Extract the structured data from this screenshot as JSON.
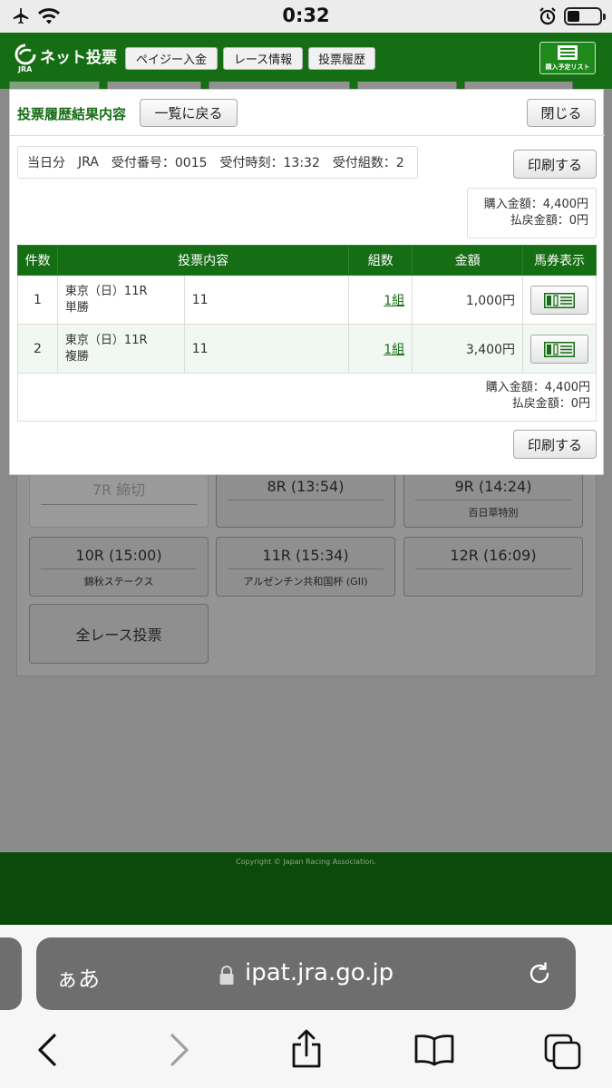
{
  "status_bar": {
    "time": "0:32"
  },
  "header": {
    "logo_text": "ネット投票",
    "logo_small": "JRA",
    "nav": [
      "ペイジー入金",
      "レース情報",
      "投票履歴"
    ],
    "purchase_list_label": "購入予定リスト"
  },
  "background": {
    "races": [
      {
        "time": "7R 締切",
        "name": ""
      },
      {
        "time": "8R (13:54)",
        "name": ""
      },
      {
        "time": "9R (14:24)",
        "name": "百日草特別"
      },
      {
        "time": "10R (15:00)",
        "name": "錦秋ステークス"
      },
      {
        "time": "11R (15:34)",
        "name": "アルゼンチン共和国杯 (GII)"
      },
      {
        "time": "12R (16:09)",
        "name": ""
      }
    ],
    "all_races_label": "全レース投票",
    "copyright": "Copyright © Japan Racing Association."
  },
  "modal": {
    "title": "投票履歴結果内容",
    "back_label": "一覧に戻る",
    "close_label": "閉じる",
    "print_label": "印刷する",
    "info": {
      "day": "当日分",
      "org": "JRA",
      "receipt_no": "受付番号：0015",
      "receipt_time": "受付時刻：13:32",
      "receipt_count": "受付組数：2"
    },
    "totals": {
      "purchase": "購入金額：4,400円",
      "refund": "払戻金額：0円"
    },
    "table": {
      "headers": [
        "件数",
        "投票内容",
        "組数",
        "金額",
        "馬券表示"
      ],
      "rows": [
        {
          "no": "1",
          "race": "東京（日）11R",
          "type": "単勝",
          "horse": "11",
          "kumi": "1組",
          "amount": "1,000円"
        },
        {
          "no": "2",
          "race": "東京（日）11R",
          "type": "複勝",
          "horse": "11",
          "kumi": "1組",
          "amount": "3,400円"
        }
      ]
    }
  },
  "browser": {
    "aa_label": "ぁあ",
    "url": "ipat.jra.go.jp"
  }
}
